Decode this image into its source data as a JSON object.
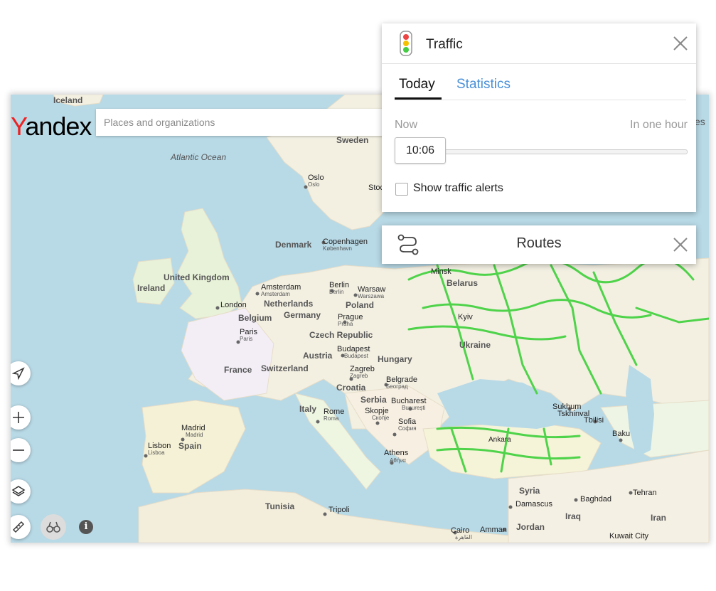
{
  "logo": {
    "first": "Y",
    "rest": "andex"
  },
  "search": {
    "placeholder": "Places and organizations",
    "right_fragment": "es"
  },
  "traffic_panel": {
    "title": "Traffic",
    "tabs": [
      "Today",
      "Statistics"
    ],
    "active_tab": "Today",
    "now_label": "Now",
    "later_label": "In one hour",
    "time": "10:06",
    "alerts_label": "Show traffic alerts",
    "alerts_checked": false
  },
  "routes_panel": {
    "title": "Routes"
  },
  "icons": {
    "traffic": "traffic-light-icon",
    "close": "close-icon",
    "routes": "route-icon",
    "locate": "locate-arrow-icon",
    "zoom_in": "plus-icon",
    "zoom_out": "minus-icon",
    "layers": "layers-icon",
    "ruler": "ruler-icon",
    "panorama": "binoculars-icon",
    "info": "info-icon"
  },
  "info_glyph": "i",
  "colors": {
    "water": "#b8d9e6",
    "land": "#f3f0e2",
    "traffic": "#4fd34a",
    "accent": "#4a90d9",
    "logo_red": "#e22222"
  },
  "map_labels": {
    "iceland": "Iceland",
    "atlantic": "Atlantic Ocean",
    "sweden": "Sweden",
    "oslo": "Oslo",
    "oslo_local": "Oslo",
    "stockholm": "Stoc",
    "denmark": "Denmark",
    "copenhagen": "Copenhagen",
    "copenhagen_local": "København",
    "uk": "United Kingdom",
    "ireland": "Ireland",
    "london": "London",
    "amsterdam": "Amsterdam",
    "amsterdam_local": "Amsterdam",
    "netherlands": "Netherlands",
    "berlin": "Berlin",
    "berlin_local": "Berlin",
    "warsaw": "Warsaw",
    "warsaw_local": "Warszawa",
    "poland": "Poland",
    "belgium": "Belgium",
    "germany": "Germany",
    "prague": "Prague",
    "prague_local": "Praha",
    "minsk": "Minsk",
    "belarus": "Belarus",
    "kyiv": "Kyiv",
    "ukraine": "Ukraine",
    "paris": "Paris",
    "paris_local": "Paris",
    "czech": "Czech Republic",
    "budapest": "Budapest",
    "budapest_local": "Budapest",
    "austria": "Austria",
    "hungary": "Hungary",
    "france": "France",
    "switzerland": "Switzerland",
    "zagreb": "Zagreb",
    "zagreb_local": "Zagreb",
    "croatia": "Croatia",
    "belgrade": "Belgrade",
    "belgrade_local": "Београд",
    "serbia": "Serbia",
    "bucharest": "Bucharest",
    "bucharest_local": "București",
    "italy": "Italy",
    "rome": "Rome",
    "rome_local": "Roma",
    "skopje": "Skopje",
    "skopje_local": "Скопје",
    "sofia": "Sofia",
    "sofia_local": "София",
    "sukhum": "Sukhum",
    "tskhinval": "Tskhinval",
    "tbilisi": "Tbilisi",
    "madrid": "Madrid",
    "madrid_local": "Madrid",
    "spain": "Spain",
    "lisbon": "Lisbon",
    "lisbon_local": "Lisboa",
    "ankara": "Ankara",
    "baku": "Baku",
    "athens": "Athens",
    "athens_local": "Αθήνα",
    "syria": "Syria",
    "damascus": "Damascus",
    "tehran": "Tehran",
    "baghdad": "Baghdad",
    "iraq": "Iraq",
    "iran": "Iran",
    "tunisia": "Tunisia",
    "tripoli": "Tripoli",
    "cairo": "Cairo",
    "cairo_local": "القاهرة",
    "amman": "Amman",
    "jordan": "Jordan",
    "kuwait": "Kuwait City"
  }
}
